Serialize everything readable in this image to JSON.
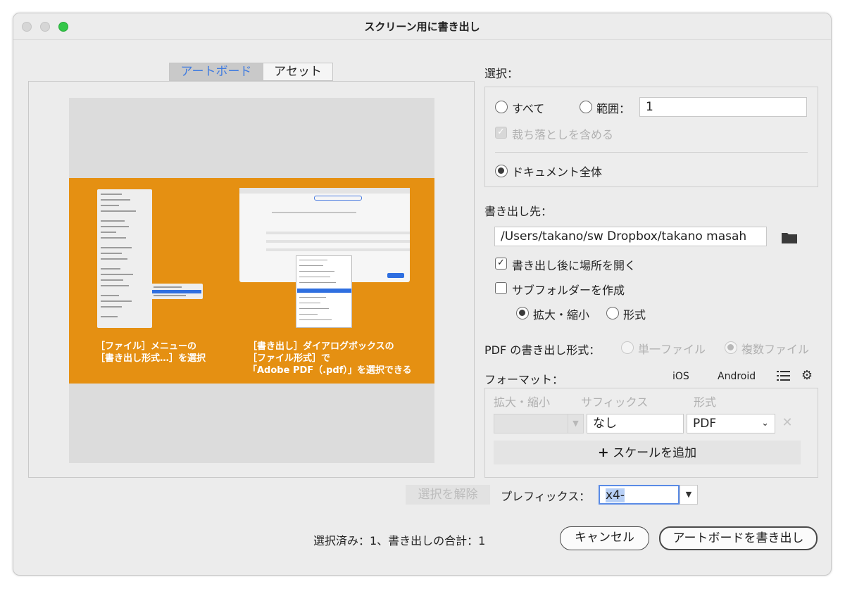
{
  "window": {
    "title": "スクリーン用に書き出し"
  },
  "tabs": [
    {
      "label": "アートボード",
      "active": true
    },
    {
      "label": "アセット",
      "active": false
    }
  ],
  "preview": {
    "caption_left": [
      "［ファイル］メニューの",
      "［書き出し形式…］を選択"
    ],
    "caption_right": [
      "［書き出し］ダイアログボックスの",
      "［ファイル形式］で",
      "「Adobe PDF（.pdf）」を選択できる"
    ],
    "artboard_color": "#e59012"
  },
  "selection": {
    "label": "選択：",
    "all_label": "すべて",
    "range_label": "範囲：",
    "range_value": "1",
    "bleed_label": "裁ち落としを含める",
    "document_label": "ドキュメント全体"
  },
  "export_to": {
    "label": "書き出し先：",
    "path": "/Users/takano/sw Dropbox/takano masah",
    "open_after_label": "書き出し後に場所を開く",
    "subfolder_label": "サブフォルダーを作成",
    "scale_label": "拡大・縮小",
    "format_label": "形式"
  },
  "pdf_export": {
    "label": "PDF の書き出し形式：",
    "single_label": "単一ファイル",
    "multi_label": "複数ファイル"
  },
  "format": {
    "label": "フォーマット：",
    "ios_label": "iOS",
    "android_label": "Android",
    "col_scale": "拡大・縮小",
    "col_suffix": "サフィックス",
    "col_format": "形式",
    "row": {
      "scale": "",
      "suffix": "なし",
      "format": "PDF"
    },
    "add_scale_label": "スケールを追加"
  },
  "bottom": {
    "deselect_label": "選択を解除",
    "prefix_label": "プレフィックス：",
    "prefix_value": "x4-",
    "summary": "選択済み：1、書き出しの合計：1",
    "cancel_label": "キャンセル",
    "export_label": "アートボードを書き出し"
  }
}
